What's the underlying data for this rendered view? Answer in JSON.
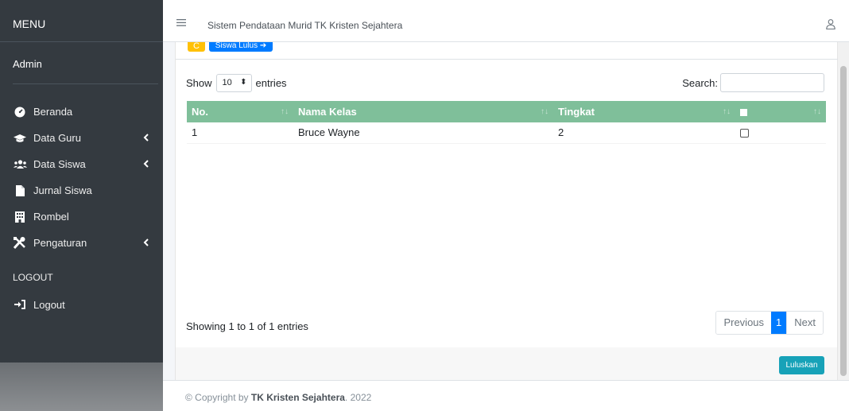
{
  "sidebar": {
    "menu_title": "MENU",
    "user_name": "Admin",
    "items": [
      {
        "label": "Beranda",
        "icon": "dashboard-icon",
        "has_submenu": false
      },
      {
        "label": "Data Guru",
        "icon": "graduation-cap-icon",
        "has_submenu": true
      },
      {
        "label": "Data Siswa",
        "icon": "users-icon",
        "has_submenu": true
      },
      {
        "label": "Jurnal Siswa",
        "icon": "file-icon",
        "has_submenu": false
      },
      {
        "label": "Rombel",
        "icon": "building-icon",
        "has_submenu": false
      },
      {
        "label": "Pengaturan",
        "icon": "tools-icon",
        "has_submenu": true
      }
    ],
    "logout_section": "LOGOUT",
    "logout_label": "Logout"
  },
  "topbar": {
    "title": "Sistem Pendataan Murid TK Kristen Sejahtera"
  },
  "toolbar": {
    "refresh_label": "C",
    "siswa_lulus_label": "Siswa Lulus ➔"
  },
  "table_controls": {
    "show_label": "Show",
    "entries_value": "10",
    "entries_label": "entries",
    "search_label": "Search:",
    "search_value": ""
  },
  "table": {
    "headers": [
      "No.",
      "Nama Kelas",
      "Tingkat",
      ""
    ],
    "rows": [
      {
        "no": "1",
        "nama_kelas": "Bruce Wayne",
        "tingkat": "2",
        "checked": false
      }
    ]
  },
  "pagination": {
    "info": "Showing 1 to 1 of 1 entries",
    "previous": "Previous",
    "current": "1",
    "next": "Next"
  },
  "actions": {
    "luluskan": "Luluskan"
  },
  "footer": {
    "prefix": "© Copyright by ",
    "brand": "TK Kristen Sejahtera",
    "suffix": ". 2022"
  },
  "colors": {
    "sidebar_bg": "#343a40",
    "table_header": "#7fbf9a",
    "primary": "#007bff",
    "warning": "#ffc107",
    "info": "#17a2b8"
  }
}
